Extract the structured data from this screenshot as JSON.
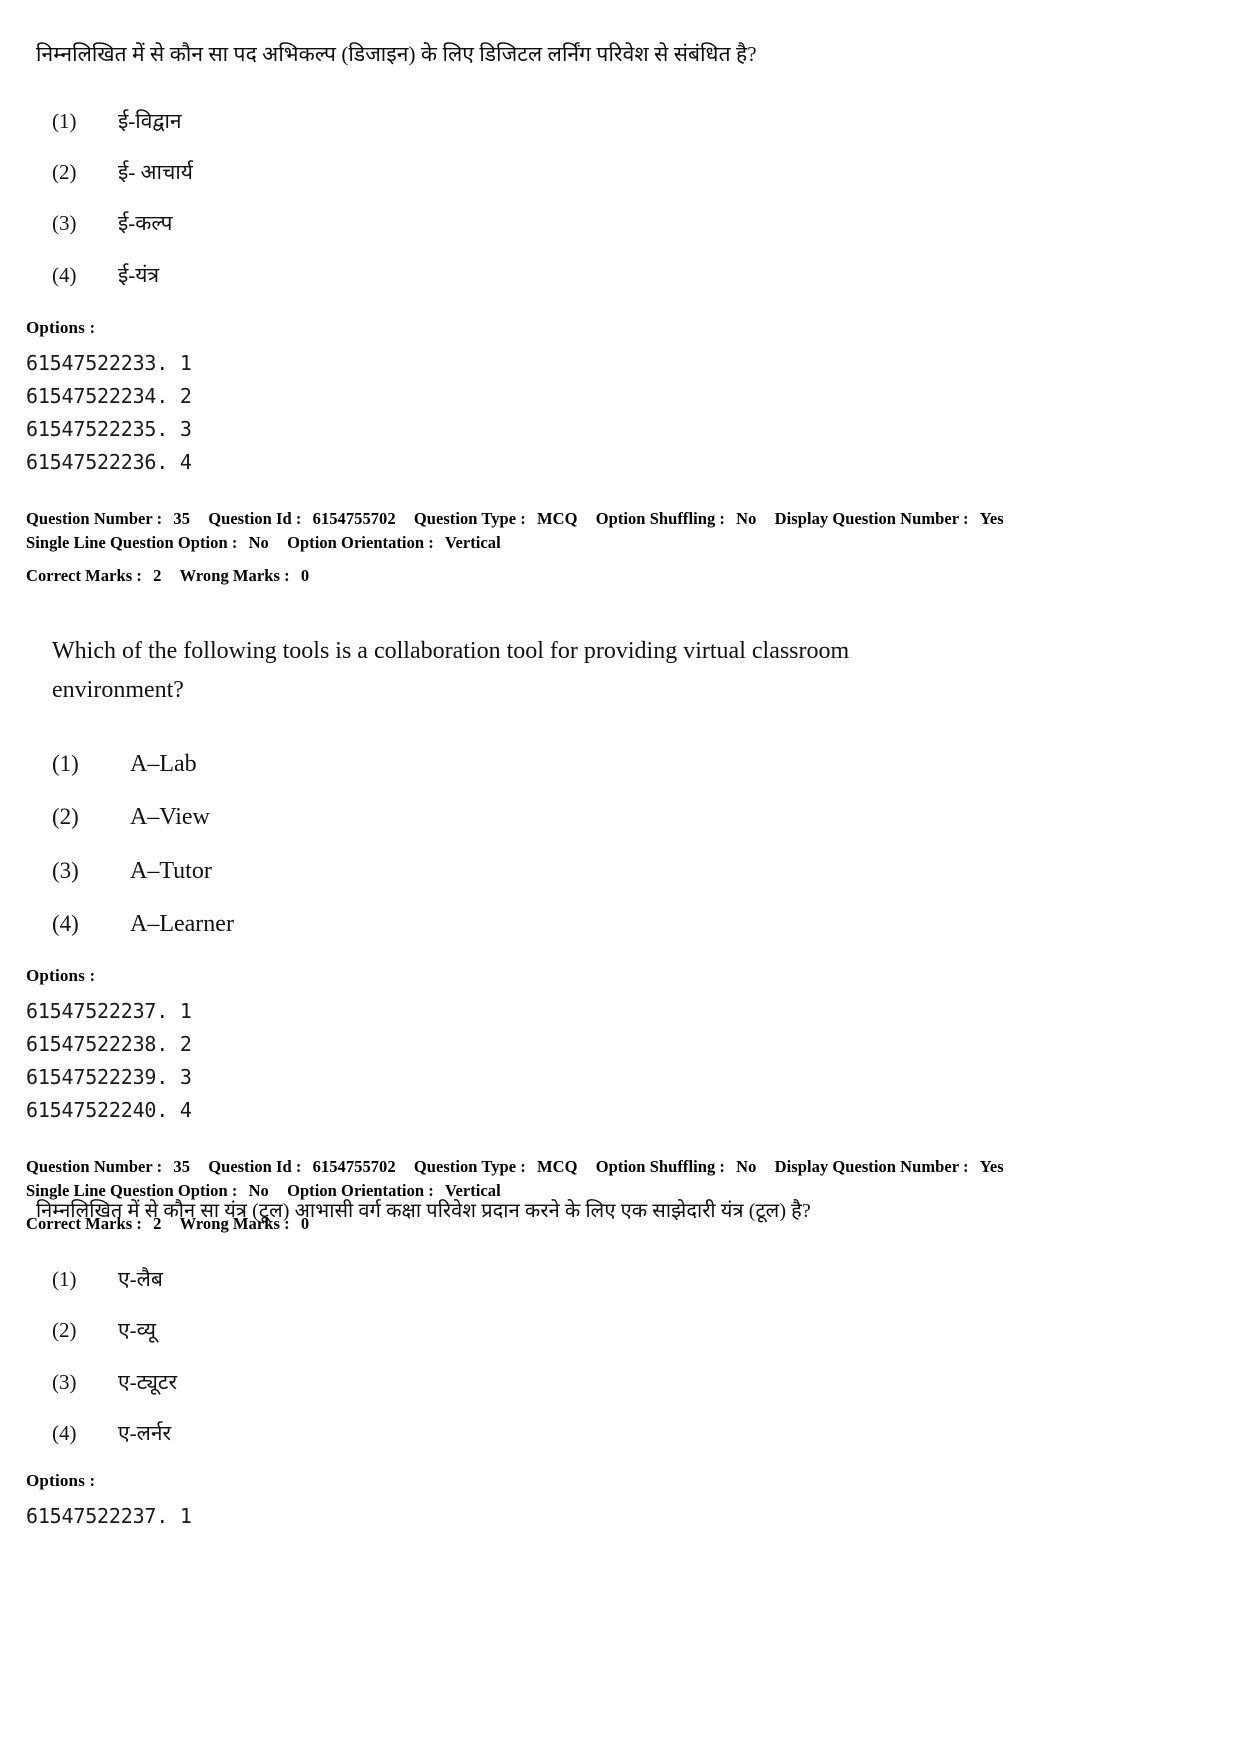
{
  "document": {
    "type": "exam-question-paper",
    "page_background": "#ffffff",
    "text_color": "#000000"
  },
  "blocks": [
    {
      "id": "question-35-hindi-top",
      "language": "hindi",
      "question_text": "निम्नलिखित में से कौन सा पद अभिकल्प (डिजाइन) के लिए डिजिटल लर्निंग परिवेश से संबंधित है?",
      "options": [
        {
          "number": "(1)",
          "text": "ई-विद्वान"
        },
        {
          "number": "(2)",
          "text": "ई- आचार्य"
        },
        {
          "number": "(3)",
          "text": "ई-कल्प"
        },
        {
          "number": "(4)",
          "text": "ई-यंत्र"
        }
      ],
      "options_label": "Options :",
      "option_ids": [
        "61547522233. 1",
        "61547522234. 2",
        "61547522235. 3",
        "61547522236. 4"
      ],
      "metadata": {
        "line1": {
          "question_number_label": "Question Number :",
          "question_number_value": "35",
          "question_id_label": "Question Id :",
          "question_id_value": "6154755702",
          "question_type_label": "Question Type :",
          "question_type_value": "MCQ",
          "option_shuffling_label": "Option Shuffling :",
          "option_shuffling_value": "No",
          "display_question_number_label": "Display Question Number :",
          "display_question_number_value": "Yes"
        },
        "line2": {
          "single_line_question_option_label": "Single Line Question Option :",
          "single_line_question_option_value": "No",
          "option_orientation_label": "Option Orientation :",
          "option_orientation_value": "Vertical"
        },
        "line3": {
          "correct_marks_label": "Correct Marks :",
          "correct_marks_value": "2",
          "wrong_marks_label": "Wrong Marks :",
          "wrong_marks_value": "0"
        }
      }
    },
    {
      "id": "question-35-english",
      "language": "english",
      "question_text_line1": "Which of the following tools is a collaboration tool for providing virtual classroom",
      "question_text_line2": "environment?",
      "options": [
        {
          "number": "(1)",
          "text": "A–Lab"
        },
        {
          "number": "(2)",
          "text": "A–View"
        },
        {
          "number": "(3)",
          "text": "A–Tutor"
        },
        {
          "number": "(4)",
          "text": "A–Learner"
        }
      ],
      "options_label": "Options :",
      "option_ids": [
        "61547522237. 1",
        "61547522238. 2",
        "61547522239. 3",
        "61547522240. 4"
      ],
      "metadata": {
        "line1": {
          "question_number_label": "Question Number :",
          "question_number_value": "35",
          "question_id_label": "Question Id :",
          "question_id_value": "6154755702",
          "question_type_label": "Question Type :",
          "question_type_value": "MCQ",
          "option_shuffling_label": "Option Shuffling :",
          "option_shuffling_value": "No",
          "display_question_number_label": "Display Question Number :",
          "display_question_number_value": "Yes"
        },
        "line2": {
          "single_line_question_option_label": "Single Line Question Option :",
          "single_line_question_option_value": "No",
          "option_orientation_label": "Option Orientation :",
          "option_orientation_value": "Vertical"
        },
        "line3": {
          "correct_marks_label": "Correct Marks :",
          "correct_marks_value": "2",
          "wrong_marks_label": "Wrong Marks :",
          "wrong_marks_value": "0"
        }
      }
    },
    {
      "id": "question-35-hindi-bottom",
      "language": "hindi",
      "question_text": "निम्नलिखित में से कौन सा यंत्र (टूल) आभासी वर्ग कक्षा परिवेश प्रदान करने के लिए एक साझेदारी यंत्र (टूल) है?",
      "options": [
        {
          "number": "(1)",
          "text": "ए-लैब"
        },
        {
          "number": "(2)",
          "text": "ए-व्यू"
        },
        {
          "number": "(3)",
          "text": "ए-ट्यूटर"
        },
        {
          "number": "(4)",
          "text": "ए-लर्नर"
        }
      ],
      "options_label": "Options :",
      "option_ids": [
        "61547522237. 1"
      ]
    }
  ]
}
